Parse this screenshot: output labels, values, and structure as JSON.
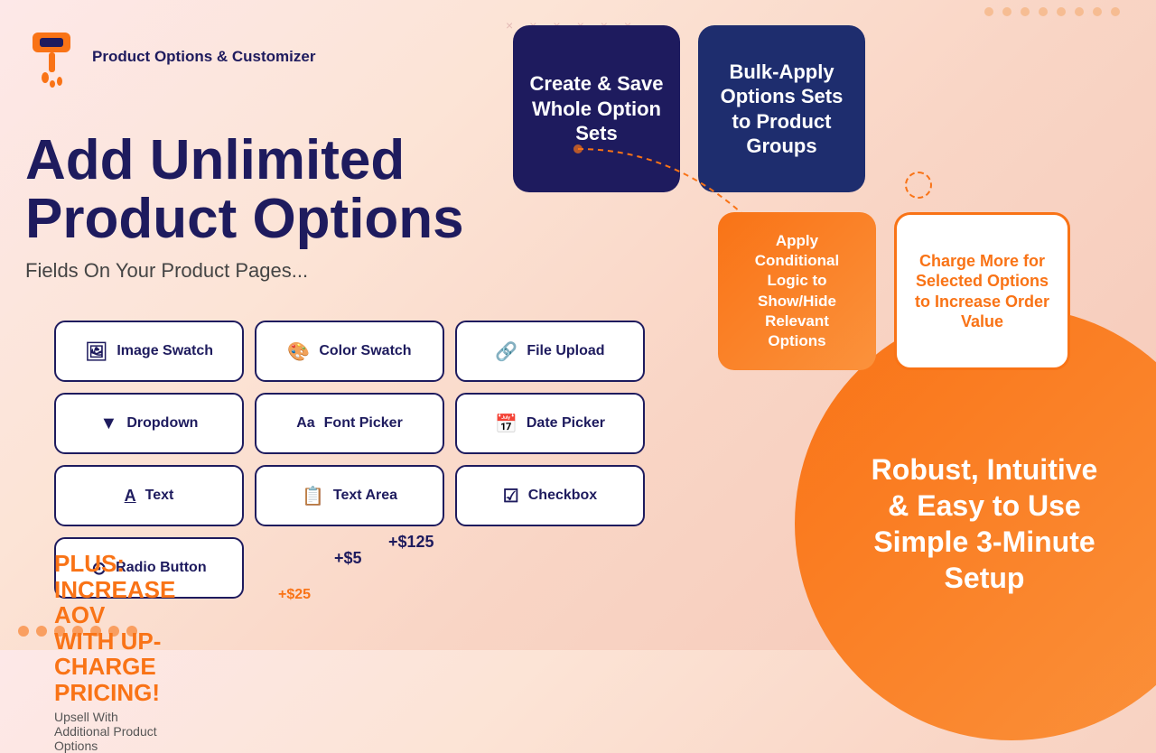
{
  "logo": {
    "brand_name": "Product Options\n& Customizer"
  },
  "hero": {
    "heading_line1": "Add Unlimited",
    "heading_line2": "Product Options",
    "subheading": "Fields On Your  Product Pages..."
  },
  "option_buttons": [
    {
      "id": "image-swatch",
      "icon": "🖼",
      "label": "Image Swatch"
    },
    {
      "id": "color-swatch",
      "icon": "🎨",
      "label": "Color Swatch"
    },
    {
      "id": "file-upload",
      "icon": "🔗",
      "label": "File Upload"
    },
    {
      "id": "dropdown",
      "icon": "▼",
      "label": "Dropdown"
    },
    {
      "id": "font-picker",
      "icon": "Aa",
      "label": "Font Picker"
    },
    {
      "id": "date-picker",
      "icon": "📅",
      "label": "Date Picker"
    },
    {
      "id": "text",
      "icon": "A̲",
      "label": "Text"
    },
    {
      "id": "text-area",
      "icon": "📋",
      "label": "Text Area"
    },
    {
      "id": "checkbox",
      "icon": "☑",
      "label": "Checkbox"
    },
    {
      "id": "radio-button",
      "icon": "⊙",
      "label": "Radio Button"
    }
  ],
  "plus_pricing": {
    "label": "PLUS: INCREASE AOV",
    "big_line": "WITH UP-CHARGE PRICING!",
    "sub": "Upsell With Additional Product Options",
    "price_1": "+$5",
    "price_2": "+$125",
    "price_3": "+$25"
  },
  "feature_cards": {
    "card1": {
      "label": "Create & Save Whole Option Sets"
    },
    "card2": {
      "label": "Bulk-Apply Options Sets to Product Groups"
    },
    "card3": {
      "label": "Apply Conditional Logic to Show/Hide Relevant Options"
    },
    "card4": {
      "label": "Charge More for Selected Options to Increase Order Value"
    }
  },
  "bottom_right": {
    "line1": "Robust, Intuitive",
    "line2": "& Easy to Use",
    "line3": "Simple 3-Minute",
    "line4": "Setup"
  },
  "decorative": {
    "x_marks": [
      "×",
      "×",
      "×",
      "×",
      "×"
    ],
    "x_marks_bottom": [
      "×",
      "×",
      "×",
      "×",
      "×",
      "×"
    ]
  }
}
